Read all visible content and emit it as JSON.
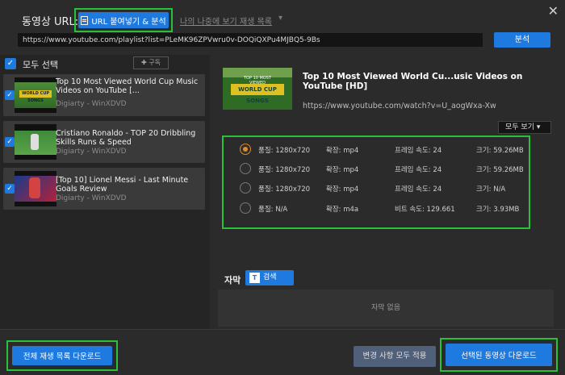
{
  "window": {
    "close": "✕"
  },
  "header": {
    "url_label": "동영상 URL:",
    "paste_button": "URL 붙여넣기 & 분석",
    "playlist_link": "나의 나중에 보기 재생 목록",
    "playlist_chevron": "▾",
    "url_value": "https://www.youtube.com/playlist?list=PLeMK96ZPVwru0v-DOQiQXPu4MJBQ5-9Bs",
    "analyze_button": "분석"
  },
  "left": {
    "select_all": "모두 선택",
    "add_button": "✚ 구독",
    "items": [
      {
        "title": "Top 10 Most Viewed World Cup Music Videos on YouTube [...",
        "meta": "Digiarty - WinXDVD",
        "thumb_text": "WORLD CUP SONGS"
      },
      {
        "title": "Cristiano Ronaldo - TOP 20 Dribbling Skills Runs & Speed",
        "meta": "Digiarty - WinXDVD"
      },
      {
        "title": "[Top 10] Lionel Messi - Last Minute Goals Review",
        "meta": "Digiarty - WinXDVD"
      }
    ]
  },
  "video": {
    "thumb_band": "WORLD CUP SONGS",
    "thumb_small": "TOP 10 MOST VIEWED",
    "title": "Top 10 Most Viewed World Cu...usic Videos on YouTube [HD]",
    "url": "https://www.youtube.com/watch?v=U_aogWxa-Xw",
    "view_all": "모두 보기 ▾"
  },
  "formats": [
    {
      "quality": "품질: 1280x720",
      "ext": "확장: mp4",
      "rate": "프레임 속도: 24",
      "size": "크기: 59.26MB",
      "selected": true
    },
    {
      "quality": "품질: 1280x720",
      "ext": "확장: mp4",
      "rate": "프레임 속도: 24",
      "size": "크기: 59.26MB",
      "selected": false
    },
    {
      "quality": "품질: 1280x720",
      "ext": "확장: mp4",
      "rate": "프레임 속도: 24",
      "size": "크기: N/A",
      "selected": false
    },
    {
      "quality": "품질: N/A",
      "ext": "확장: m4a",
      "rate": "비트 속도: 129.661",
      "size": "크기: 3.93MB",
      "selected": false
    }
  ],
  "subtitles": {
    "label": "자막",
    "search_button": "검색",
    "search_icon": "T",
    "empty": "자막 없음"
  },
  "footer": {
    "download_all": "전체 재생 목록 다운로드",
    "apply_all": "변경 사항 모두 적용",
    "download_selected": "선택된 동영상 다운로드"
  },
  "colors": {
    "accent": "#1f7ae0",
    "highlight": "#27c23a",
    "radio_selected": "#e48b2a"
  }
}
